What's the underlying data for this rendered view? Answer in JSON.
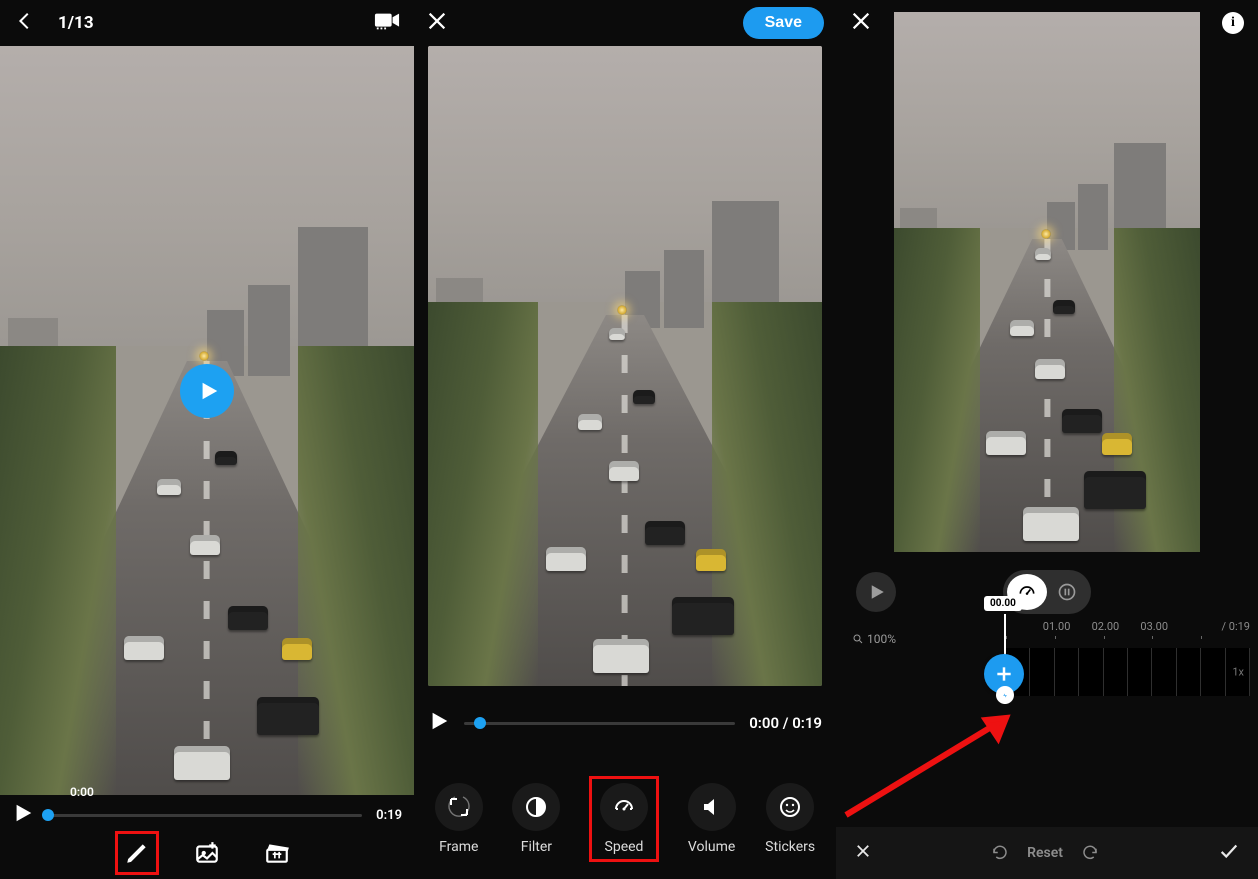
{
  "panel1": {
    "counter": "1/13",
    "current_time": "0:00",
    "duration": "0:19",
    "tools": {
      "edit": "edit",
      "media": "media",
      "clip": "clip"
    }
  },
  "panel2": {
    "save_label": "Save",
    "current_time": "0:00",
    "duration": "0:19",
    "time_display": "0:00 / 0:19",
    "tools": [
      {
        "key": "frame",
        "label": "Frame"
      },
      {
        "key": "filter",
        "label": "Filter"
      },
      {
        "key": "speed",
        "label": "Speed"
      },
      {
        "key": "volume",
        "label": "Volume"
      },
      {
        "key": "stickers",
        "label": "Stickers"
      }
    ]
  },
  "panel3": {
    "zoom": "100%",
    "playhead": "00.00",
    "ticks": [
      "01.00",
      "02.00",
      "03.00"
    ],
    "duration": "0:19",
    "speed_suffix": "1x",
    "reset_label": "Reset"
  }
}
